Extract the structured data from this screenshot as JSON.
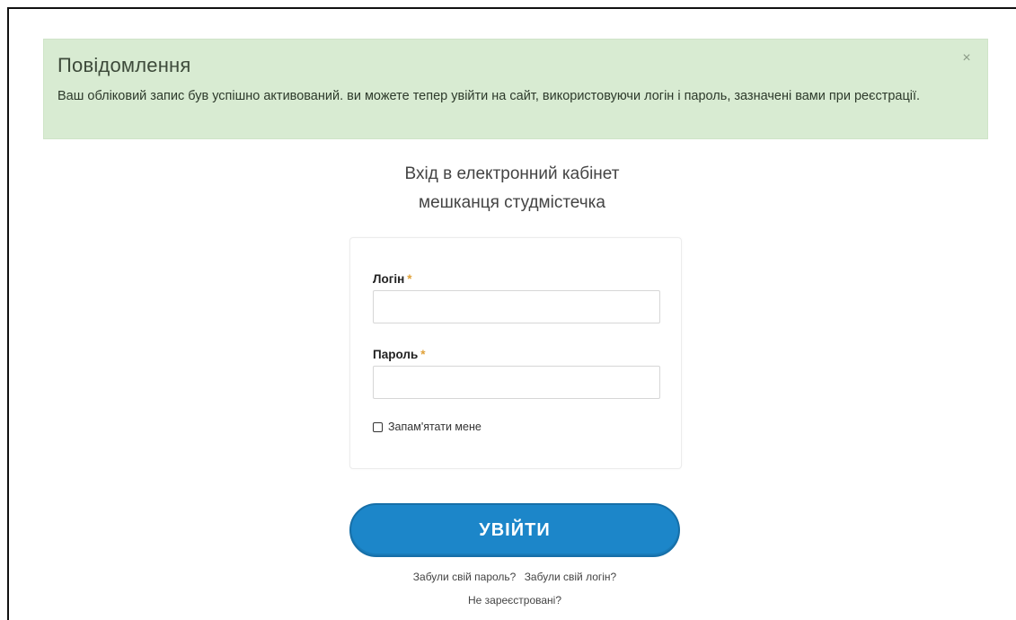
{
  "alert": {
    "title": "Повідомлення",
    "text": "Ваш обліковий запис був успішно активований. ви можете тепер увійти на сайт, використовуючи логін і пароль, зазначені вами при реєстрації.",
    "close_symbol": "×",
    "background": "#d8ebd2"
  },
  "heading": {
    "line1": "Вхід в електронний кабінет",
    "line2": "мешканця студмістечка"
  },
  "form": {
    "login_label": "Логін",
    "password_label": "Пароль",
    "required_mark": "*",
    "login_value": "",
    "password_value": "",
    "remember_label": "Запам'ятати мене",
    "remember_checked": false
  },
  "submit": {
    "label": "УВІЙТИ",
    "color": "#1c86c9"
  },
  "links": {
    "forgot_password": "Забули свій пароль?",
    "forgot_login": "Забули свій логін?",
    "not_registered": "Не зареєстровані?"
  },
  "icons": {
    "close": "close-icon",
    "checkbox": "checkbox-unchecked-icon"
  }
}
